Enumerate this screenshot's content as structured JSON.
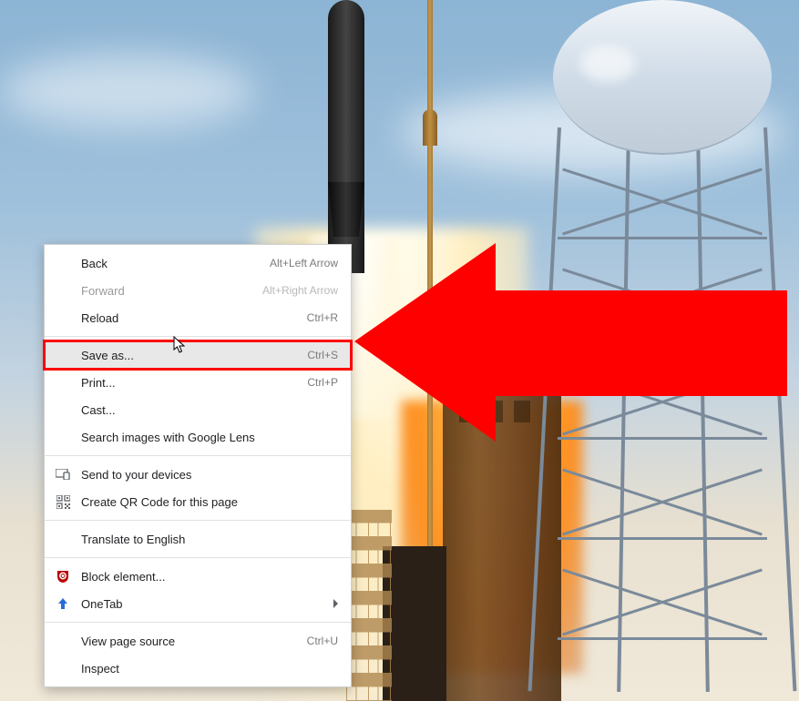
{
  "menu": {
    "items": [
      {
        "label": "Back",
        "shortcut": "Alt+Left Arrow",
        "icon": null,
        "disabled": false,
        "highlighted": false,
        "submenu": false
      },
      {
        "label": "Forward",
        "shortcut": "Alt+Right Arrow",
        "icon": null,
        "disabled": true,
        "highlighted": false,
        "submenu": false
      },
      {
        "label": "Reload",
        "shortcut": "Ctrl+R",
        "icon": null,
        "disabled": false,
        "highlighted": false,
        "submenu": false
      }
    ],
    "group2": [
      {
        "label": "Save as...",
        "shortcut": "Ctrl+S",
        "icon": null,
        "disabled": false,
        "highlighted": true,
        "submenu": false
      },
      {
        "label": "Print...",
        "shortcut": "Ctrl+P",
        "icon": null,
        "disabled": false,
        "highlighted": false,
        "submenu": false
      },
      {
        "label": "Cast...",
        "shortcut": "",
        "icon": null,
        "disabled": false,
        "highlighted": false,
        "submenu": false
      },
      {
        "label": "Search images with Google Lens",
        "shortcut": "",
        "icon": null,
        "disabled": false,
        "highlighted": false,
        "submenu": false
      }
    ],
    "group3": [
      {
        "label": "Send to your devices",
        "shortcut": "",
        "icon": "devices-icon",
        "disabled": false,
        "highlighted": false,
        "submenu": false
      },
      {
        "label": "Create QR Code for this page",
        "shortcut": "",
        "icon": "qr-icon",
        "disabled": false,
        "highlighted": false,
        "submenu": false
      }
    ],
    "group4": [
      {
        "label": "Translate to English",
        "shortcut": "",
        "icon": null,
        "disabled": false,
        "highlighted": false,
        "submenu": false
      }
    ],
    "group5": [
      {
        "label": "Block element...",
        "shortcut": "",
        "icon": "ublock-icon",
        "disabled": false,
        "highlighted": false,
        "submenu": false
      },
      {
        "label": "OneTab",
        "shortcut": "",
        "icon": "onetab-icon",
        "disabled": false,
        "highlighted": false,
        "submenu": true
      }
    ],
    "group6": [
      {
        "label": "View page source",
        "shortcut": "Ctrl+U",
        "icon": null,
        "disabled": false,
        "highlighted": false,
        "submenu": false
      },
      {
        "label": "Inspect",
        "shortcut": "",
        "icon": null,
        "disabled": false,
        "highlighted": false,
        "submenu": false
      }
    ]
  },
  "annotation": {
    "arrow_color": "#ff0000"
  }
}
